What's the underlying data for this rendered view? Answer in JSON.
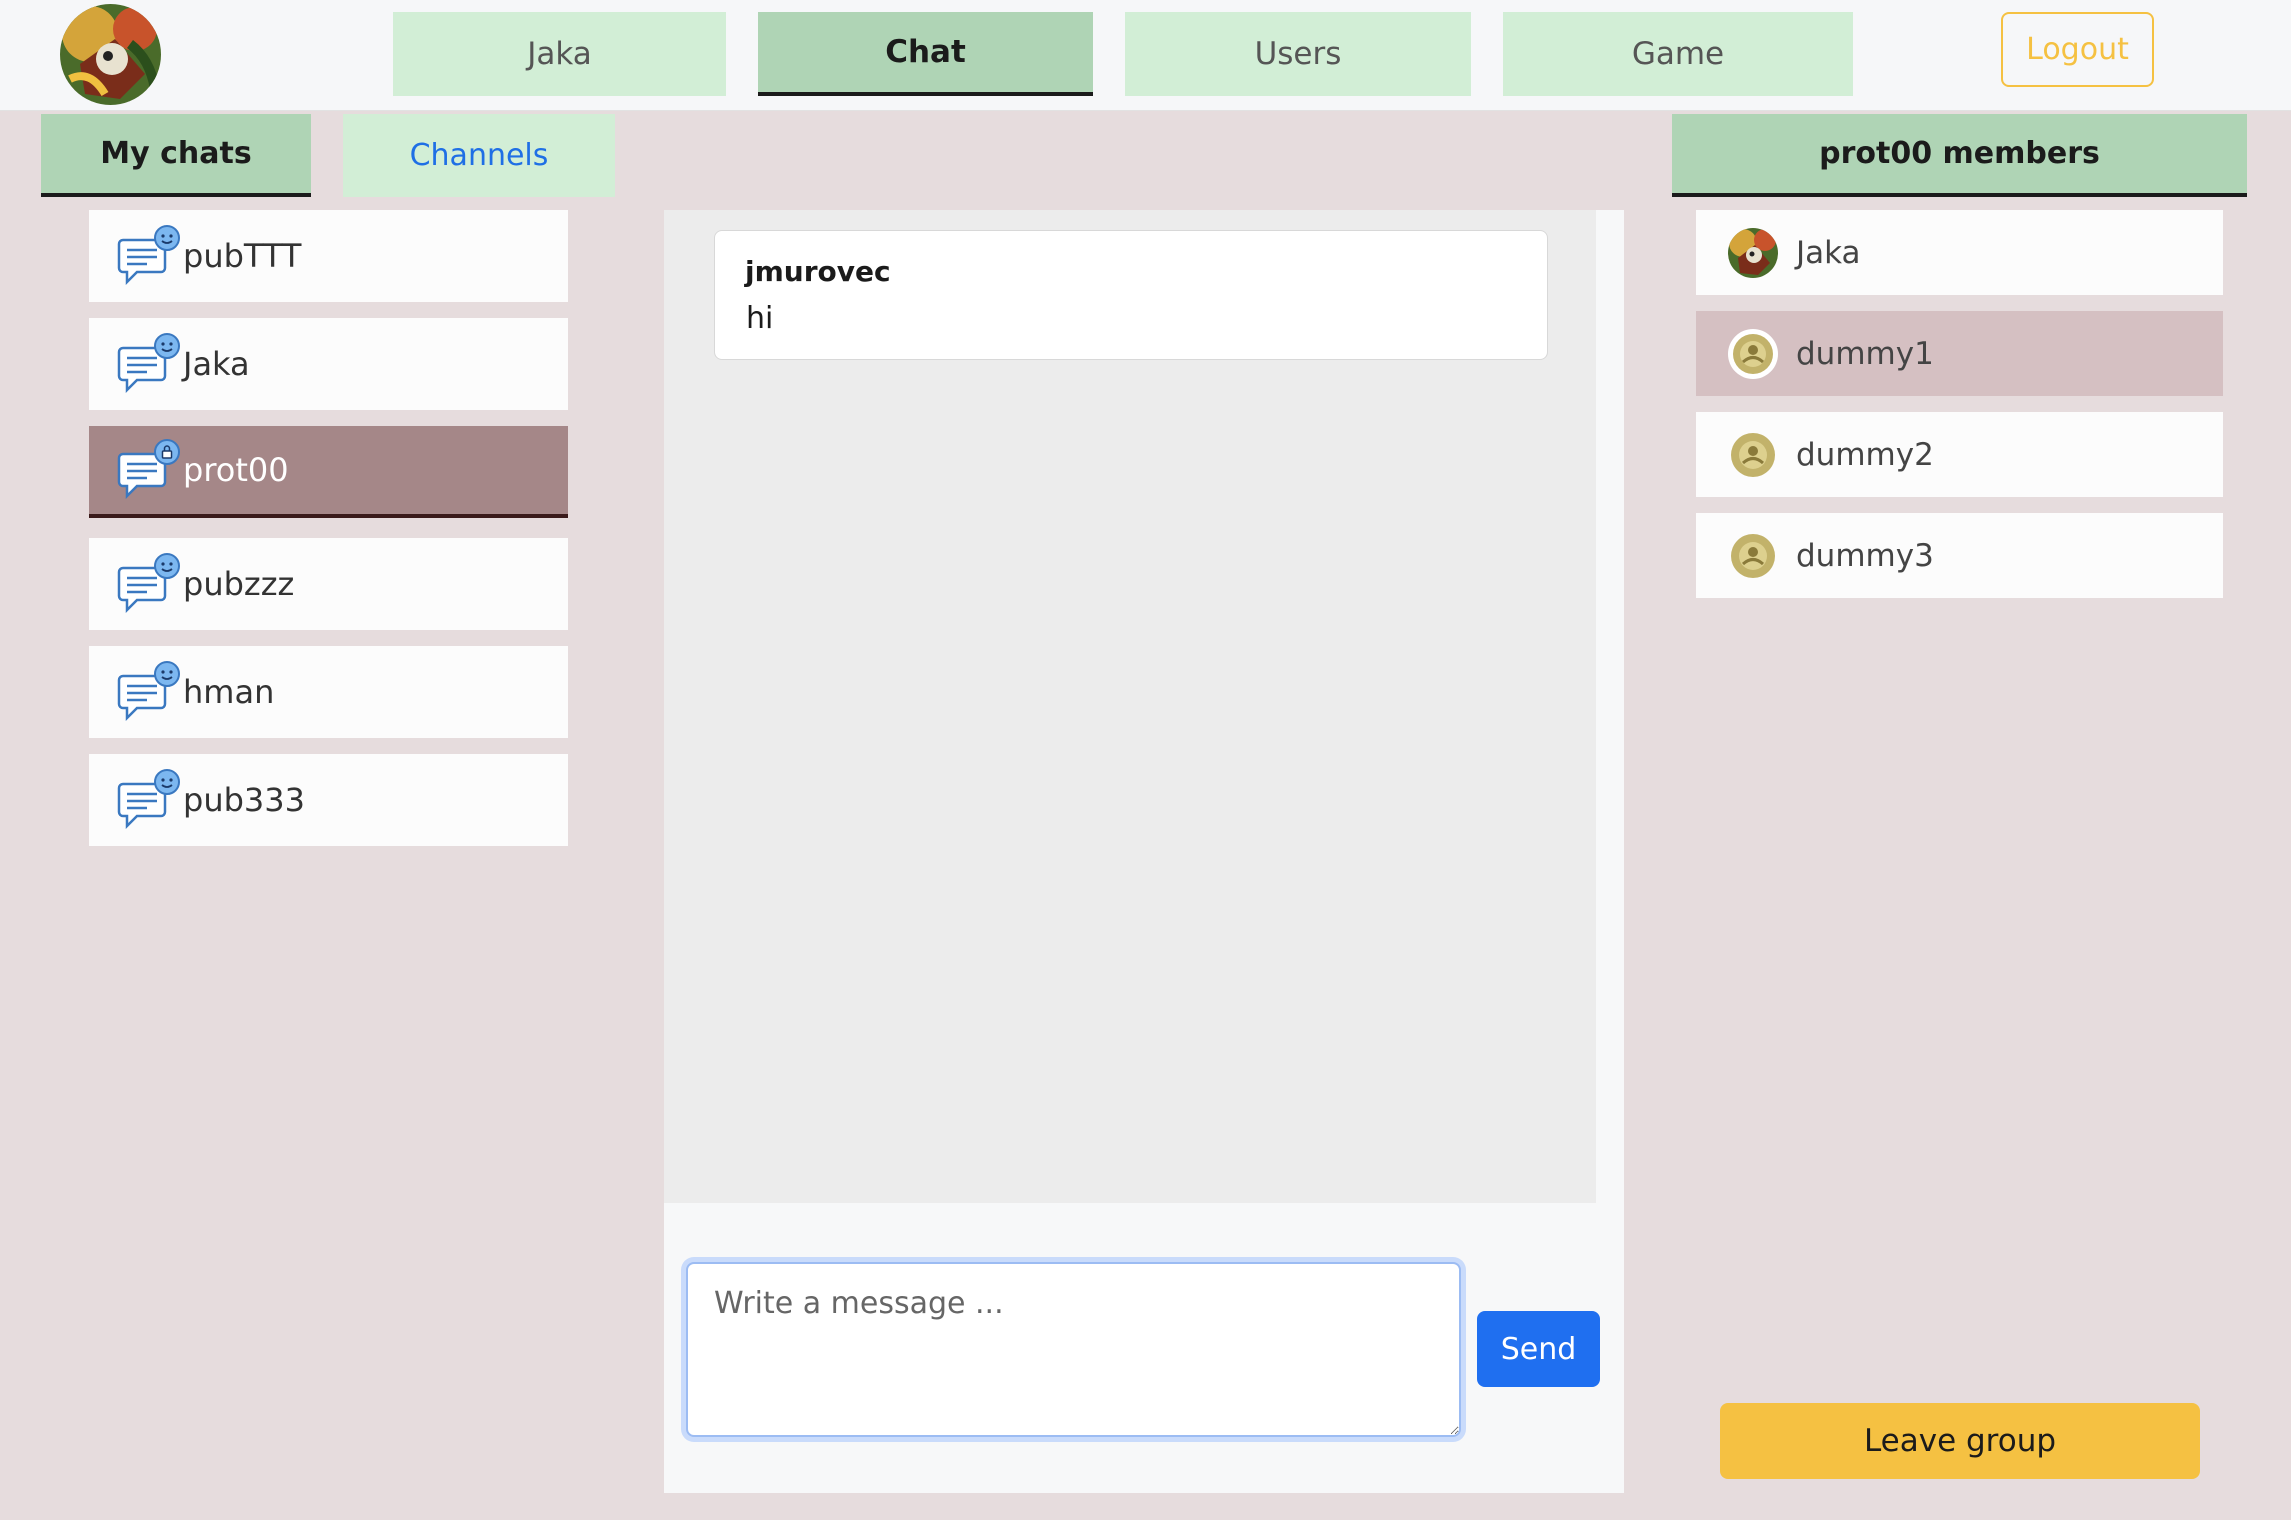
{
  "navbar": {
    "tabs": [
      {
        "label": "Jaka"
      },
      {
        "label": "Chat"
      },
      {
        "label": "Users"
      },
      {
        "label": "Game"
      }
    ],
    "logout_label": "Logout"
  },
  "subtabs": {
    "my_chats": "My chats",
    "channels": "Channels"
  },
  "chats": [
    {
      "name": "pubTTT",
      "icon": "chat-public-icon"
    },
    {
      "name": "Jaka",
      "icon": "chat-public-icon"
    },
    {
      "name": "prot00",
      "icon": "chat-protected-icon",
      "selected": true
    },
    {
      "name": "pubzzz",
      "icon": "chat-public-icon"
    },
    {
      "name": "hman",
      "icon": "chat-public-icon"
    },
    {
      "name": "pub333",
      "icon": "chat-public-icon"
    }
  ],
  "conversation": {
    "messages": [
      {
        "author": "jmurovec",
        "text": "hi"
      }
    ],
    "input_placeholder": "Write a message ...",
    "send_label": "Send"
  },
  "members": {
    "title": "prot00 members",
    "list": [
      {
        "name": "Jaka"
      },
      {
        "name": "dummy1"
      },
      {
        "name": "dummy2"
      },
      {
        "name": "dummy3"
      }
    ],
    "leave_label": "Leave group"
  },
  "colors": {
    "background": "#e6dcdd",
    "tab_active": "#afd4b5",
    "tab_inactive": "#d2eed6",
    "selected_chat": "#a58788",
    "primary_blue": "#1f6ff0",
    "warning_yellow": "#f5c142"
  }
}
